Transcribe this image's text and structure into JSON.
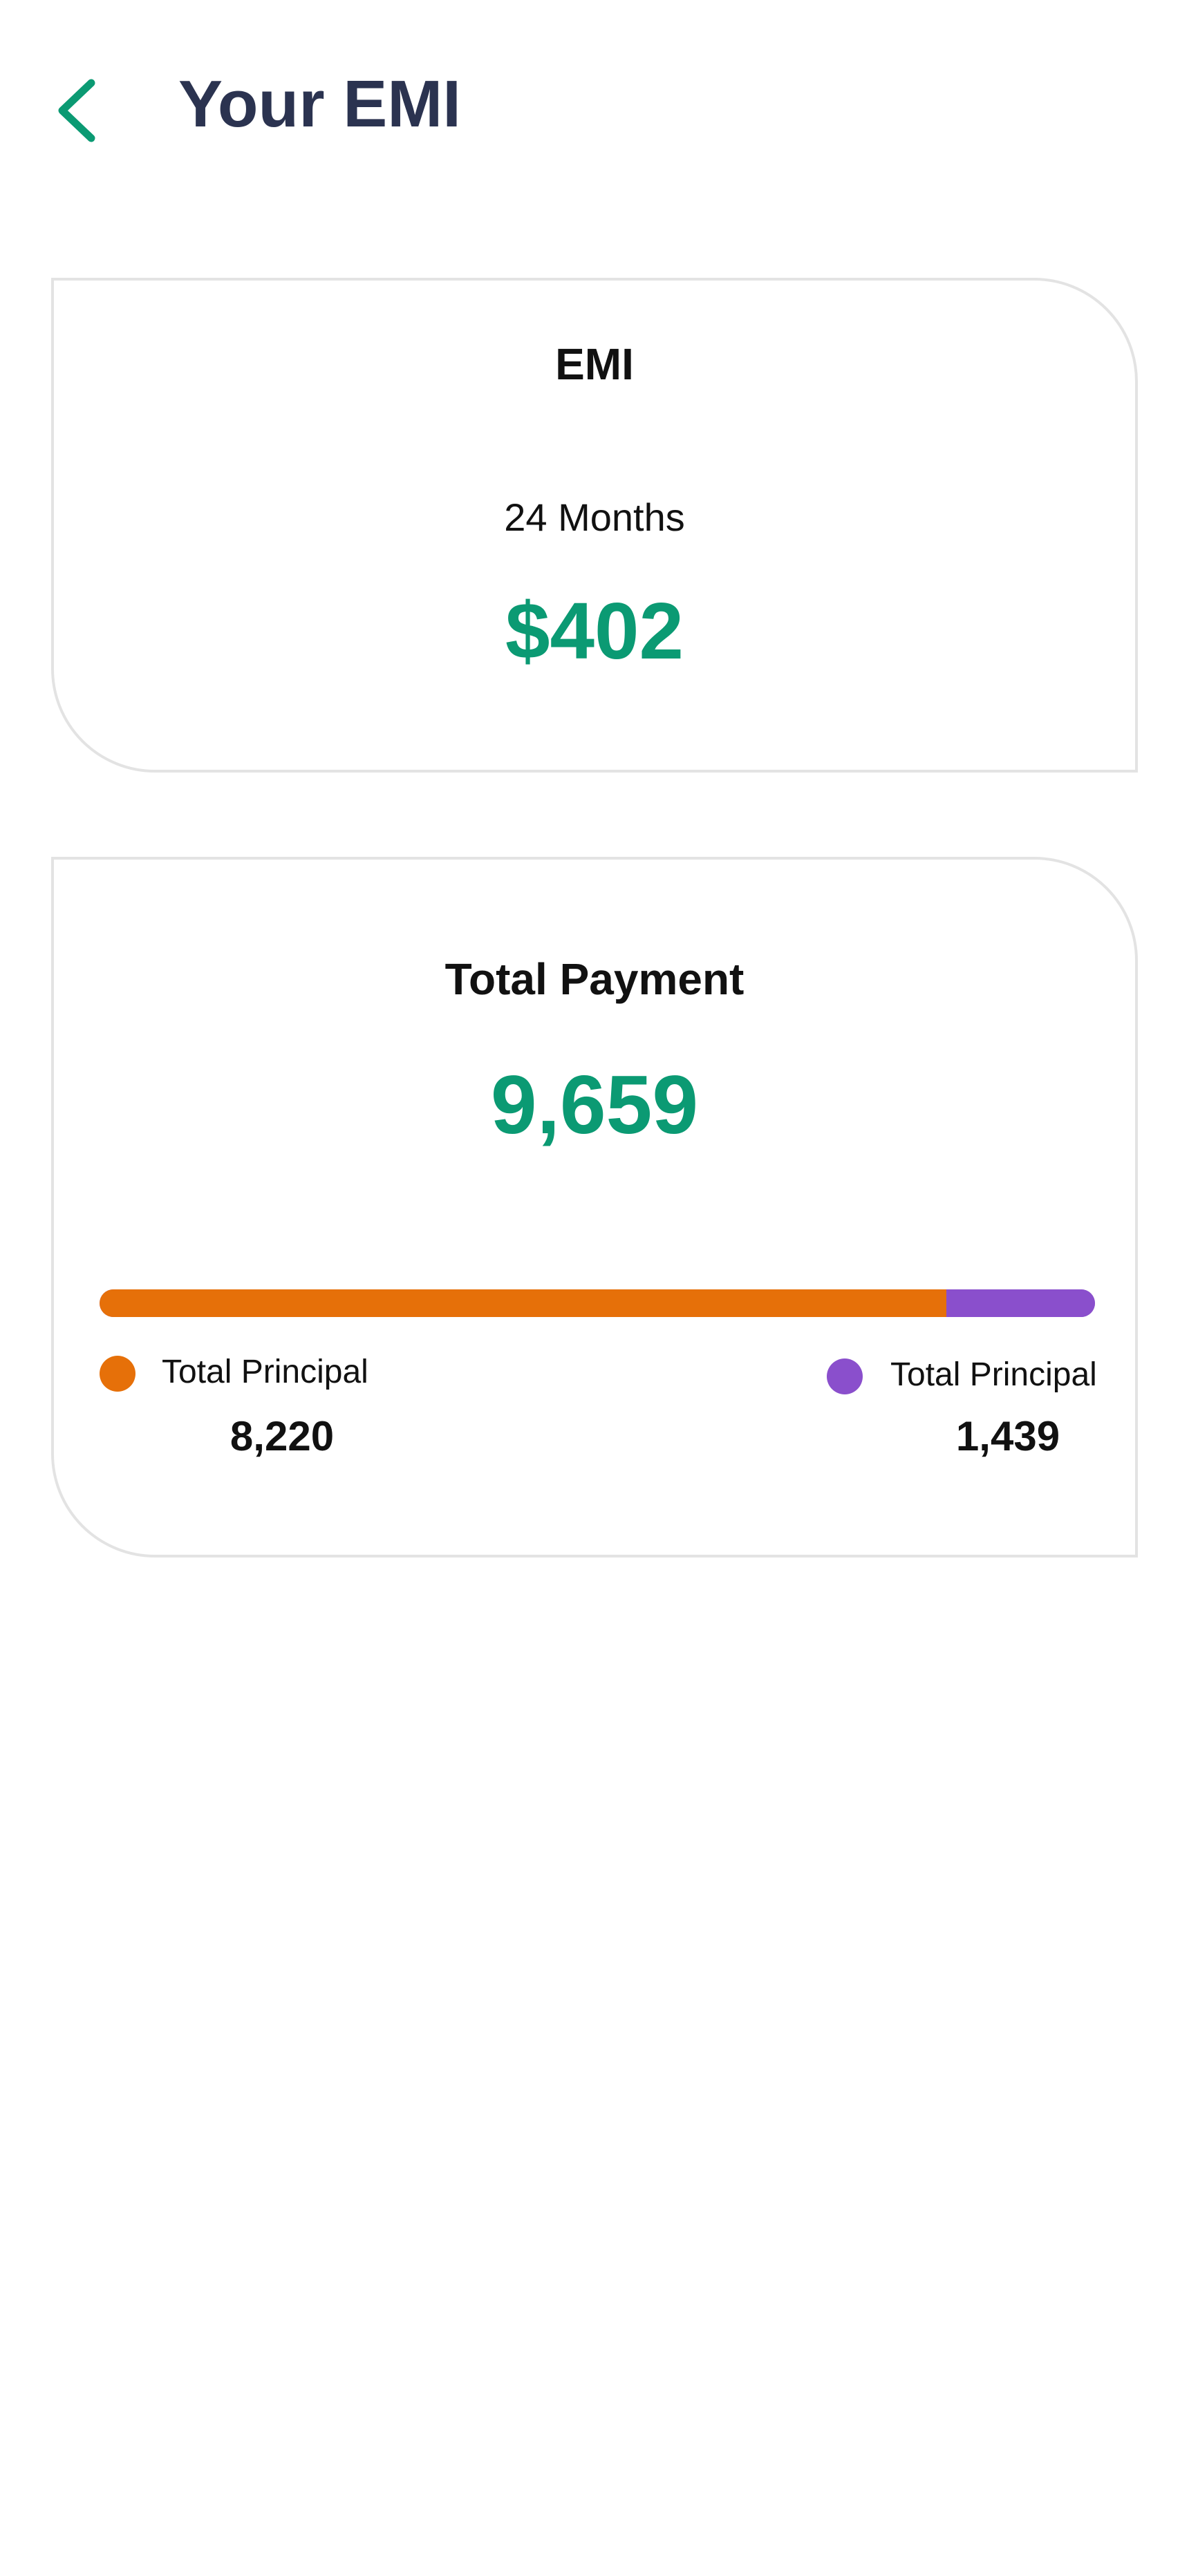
{
  "header": {
    "title": "Your EMI",
    "back_icon": "chevron-left-icon"
  },
  "emi_card": {
    "heading": "EMI",
    "duration": "24 Months",
    "amount": "$402"
  },
  "total_card": {
    "heading": "Total Payment",
    "amount": "9,659",
    "breakdown": {
      "principal_fraction": 0.851,
      "interest_fraction": 0.149
    },
    "legend": [
      {
        "label": "Total Principal",
        "value": "8,220",
        "color": "#e67009"
      },
      {
        "label": "Total Principal",
        "value": "1,439",
        "color": "#8a4fcc"
      }
    ]
  },
  "colors": {
    "accent": "#0b9a73",
    "title": "#2b3350",
    "principal": "#e67009",
    "interest": "#8a4fcc",
    "card_border": "#e3e3e3"
  }
}
